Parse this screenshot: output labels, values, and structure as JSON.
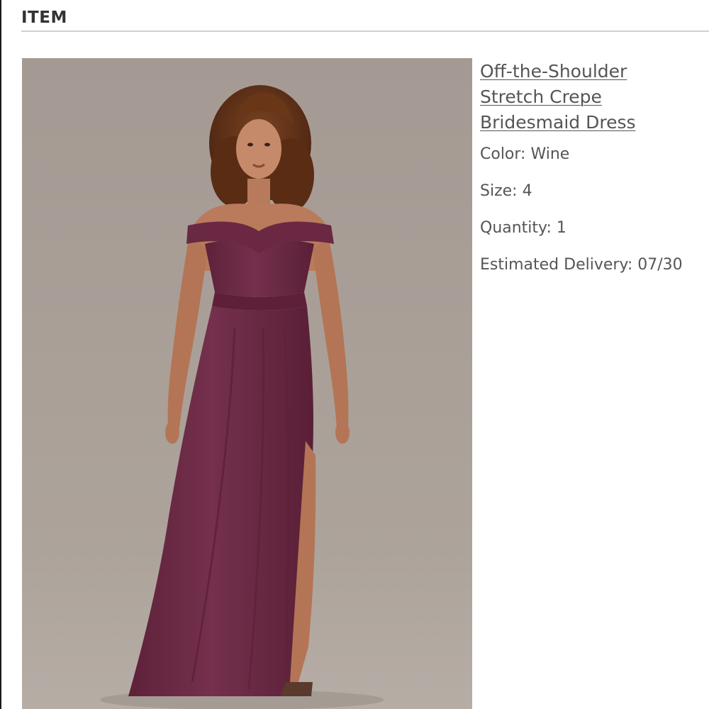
{
  "section": {
    "heading": "ITEM"
  },
  "product": {
    "image_alt": "Off-the-Shoulder Stretch Crepe Bridesmaid Dress",
    "name": "Off-the-Shoulder Stretch Crepe Bridesmaid Dress",
    "color_line": "Color: Wine",
    "size_line": "Size: 4",
    "quantity_line": "Quantity: 1",
    "delivery_line": "Estimated Delivery: 07/30"
  },
  "colors": {
    "dress": "#6e2a47",
    "backdrop": "#a89e96",
    "text": "#555555"
  }
}
